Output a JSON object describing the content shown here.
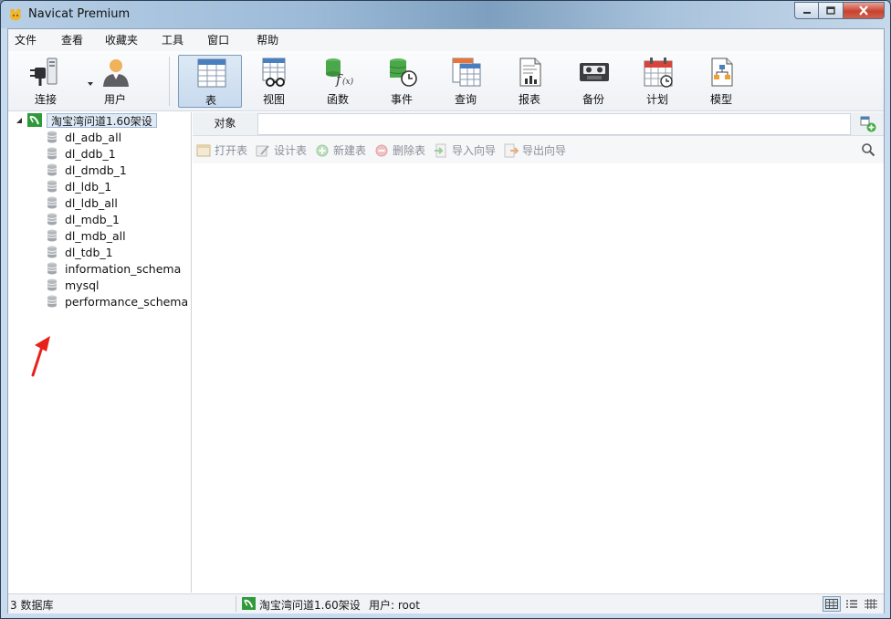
{
  "window": {
    "title": "Navicat Premium",
    "controls": [
      "minimize",
      "maximize",
      "close"
    ]
  },
  "menu": [
    "文件",
    "查看",
    "收藏夹",
    "工具",
    "窗口",
    "帮助"
  ],
  "toolbar": {
    "connect_label": "连接",
    "user_label": "用户",
    "items": [
      {
        "label": "表",
        "icon": "table-icon",
        "active": true
      },
      {
        "label": "视图",
        "icon": "view-icon",
        "active": false
      },
      {
        "label": "函数",
        "icon": "function-icon",
        "active": false
      },
      {
        "label": "事件",
        "icon": "event-icon",
        "active": false
      },
      {
        "label": "查询",
        "icon": "query-icon",
        "active": false
      },
      {
        "label": "报表",
        "icon": "report-icon",
        "active": false
      },
      {
        "label": "备份",
        "icon": "backup-icon",
        "active": false
      },
      {
        "label": "计划",
        "icon": "schedule-icon",
        "active": false
      },
      {
        "label": "模型",
        "icon": "model-icon",
        "active": false
      }
    ]
  },
  "tree": {
    "connection": "淘宝湾问道1.60架设",
    "databases": [
      "dl_adb_all",
      "dl_ddb_1",
      "dl_dmdb_1",
      "dl_ldb_1",
      "dl_ldb_all",
      "dl_mdb_1",
      "dl_mdb_all",
      "dl_tdb_1",
      "information_schema",
      "mysql",
      "performance_schema"
    ]
  },
  "objects": {
    "tab_label": "对象",
    "actions": [
      "打开表",
      "设计表",
      "新建表",
      "删除表",
      "导入向导",
      "导出向导"
    ]
  },
  "status": {
    "db_count": "3 数据库",
    "connection": "淘宝湾问道1.60架设",
    "user": "用户: root"
  },
  "colors": {
    "accent": "#7d9ab8",
    "annotation_arrow": "#e8221b",
    "connection_green": "#2f9a3a"
  }
}
